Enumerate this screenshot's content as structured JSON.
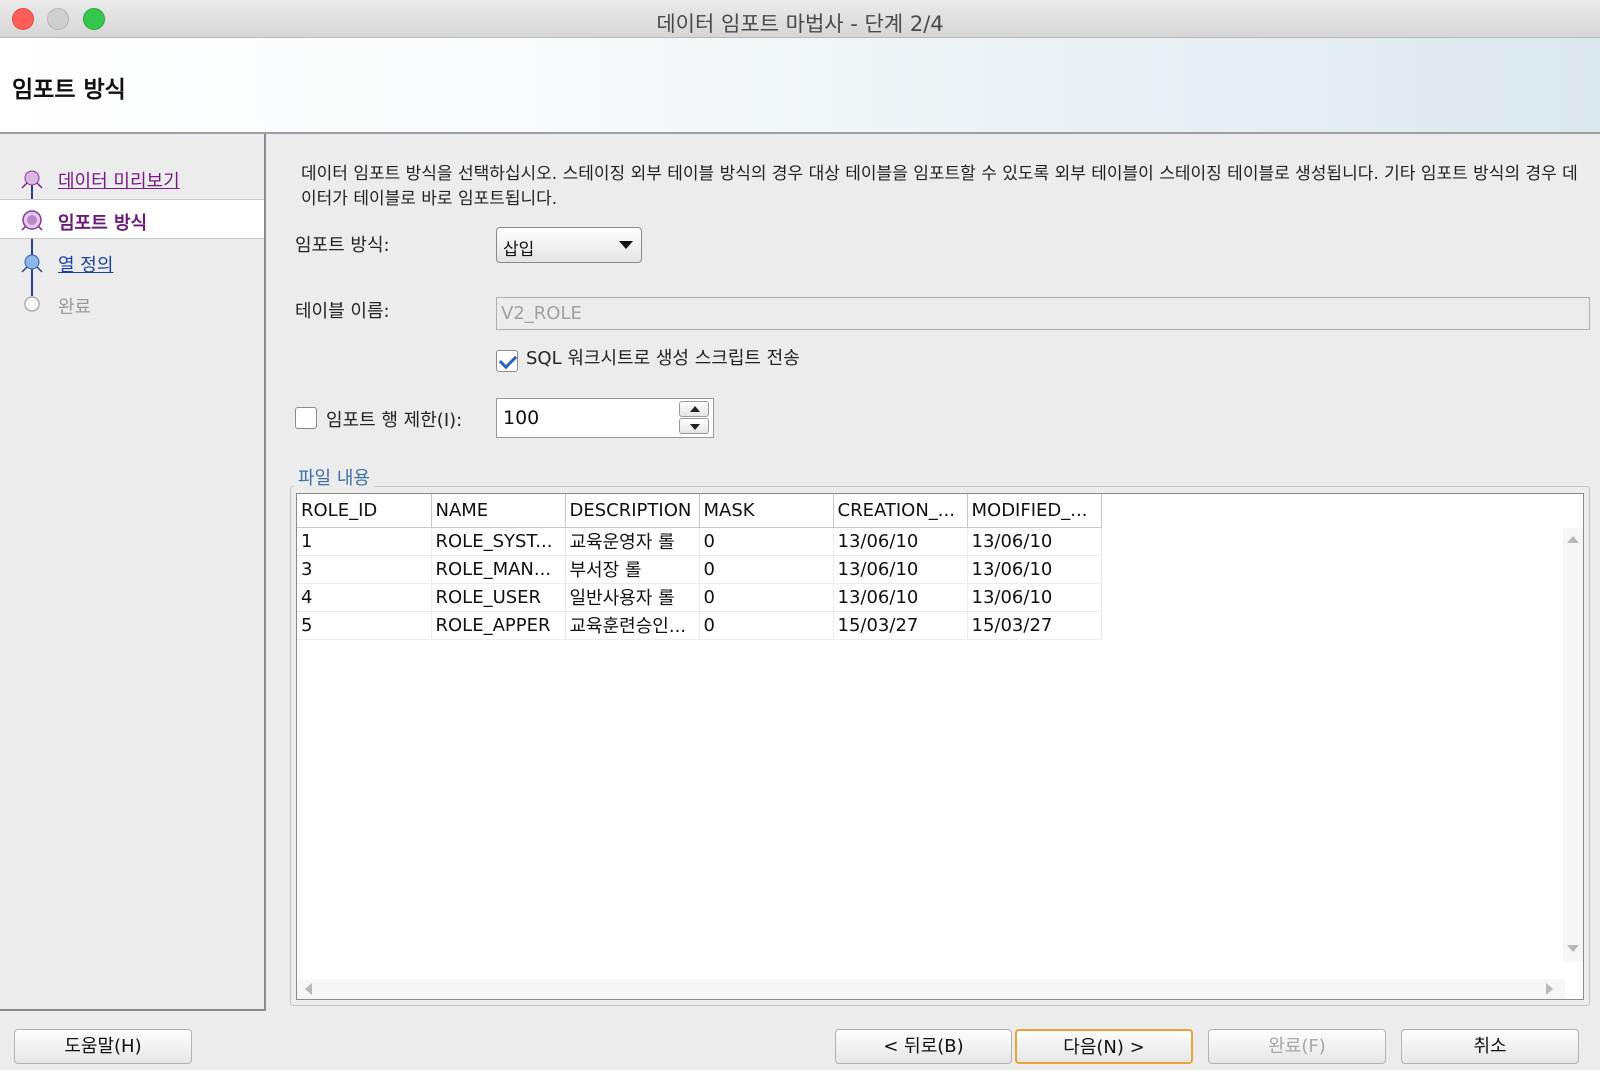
{
  "window": {
    "title": "데이터 임포트 마법사 - 단계 2/4"
  },
  "header": {
    "title": "임포트 방식"
  },
  "nav": {
    "items": [
      {
        "label": "데이터 미리보기",
        "state": "visited"
      },
      {
        "label": "임포트 방식",
        "state": "current"
      },
      {
        "label": "열 정의",
        "state": "link"
      },
      {
        "label": "완료",
        "state": "disabled"
      }
    ]
  },
  "main": {
    "description": "데이터 임포트 방식을 선택하십시오. 스테이징 외부 테이블 방식의 경우 대상 테이블을 임포트할 수 있도록 외부 테이블이 스테이징 테이블로 생성됩니다. 기타 임포트 방식의 경우 데이터가 테이블로 바로 임포트됩니다.",
    "import_method_label": "임포트 방식:",
    "import_method_value": "삽입",
    "table_name_label": "테이블 이름:",
    "table_name_value": "V2_ROLE",
    "send_script_label": "SQL 워크시트로 생성 스크립트 전송",
    "send_script_checked": true,
    "row_limit_label": "임포트 행 제한(I):",
    "row_limit_checked": false,
    "row_limit_value": "100",
    "file_contents_label": "파일 내용",
    "table": {
      "columns": [
        "ROLE_ID",
        "NAME",
        "DESCRIPTION",
        "MASK",
        "CREATION_...",
        "MODIFIED_..."
      ],
      "rows": [
        [
          "1",
          "ROLE_SYST...",
          "교육운영자 롤",
          "0",
          "13/06/10",
          "13/06/10"
        ],
        [
          "3",
          "ROLE_MAN...",
          "부서장 롤",
          "0",
          "13/06/10",
          "13/06/10"
        ],
        [
          "4",
          "ROLE_USER",
          "일반사용자 롤",
          "0",
          "13/06/10",
          "13/06/10"
        ],
        [
          "5",
          "ROLE_APPER",
          "교육훈련승인...",
          "0",
          "15/03/27",
          "15/03/27"
        ]
      ]
    }
  },
  "buttons": {
    "help": "도움말(H)",
    "back": "< 뒤로(B)",
    "next": "다음(N) >",
    "finish": "완료(F)",
    "cancel": "취소"
  },
  "colors": {
    "accent_border": "#e8a33a",
    "nav_current": "#6a1a7a",
    "nav_link": "#1a3fa8",
    "group_title": "#3d6fa8"
  }
}
